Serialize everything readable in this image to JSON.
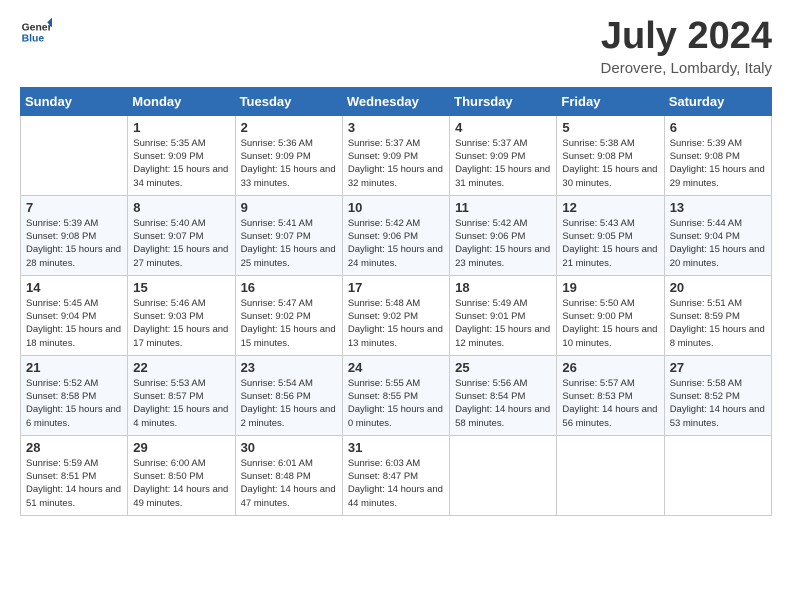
{
  "header": {
    "logo_line1": "General",
    "logo_line2": "Blue",
    "title": "July 2024",
    "subtitle": "Derovere, Lombardy, Italy"
  },
  "weekdays": [
    "Sunday",
    "Monday",
    "Tuesday",
    "Wednesday",
    "Thursday",
    "Friday",
    "Saturday"
  ],
  "weeks": [
    [
      {
        "day": "",
        "empty": true
      },
      {
        "day": "1",
        "sunrise": "Sunrise: 5:35 AM",
        "sunset": "Sunset: 9:09 PM",
        "daylight": "Daylight: 15 hours and 34 minutes."
      },
      {
        "day": "2",
        "sunrise": "Sunrise: 5:36 AM",
        "sunset": "Sunset: 9:09 PM",
        "daylight": "Daylight: 15 hours and 33 minutes."
      },
      {
        "day": "3",
        "sunrise": "Sunrise: 5:37 AM",
        "sunset": "Sunset: 9:09 PM",
        "daylight": "Daylight: 15 hours and 32 minutes."
      },
      {
        "day": "4",
        "sunrise": "Sunrise: 5:37 AM",
        "sunset": "Sunset: 9:09 PM",
        "daylight": "Daylight: 15 hours and 31 minutes."
      },
      {
        "day": "5",
        "sunrise": "Sunrise: 5:38 AM",
        "sunset": "Sunset: 9:08 PM",
        "daylight": "Daylight: 15 hours and 30 minutes."
      },
      {
        "day": "6",
        "sunrise": "Sunrise: 5:39 AM",
        "sunset": "Sunset: 9:08 PM",
        "daylight": "Daylight: 15 hours and 29 minutes."
      }
    ],
    [
      {
        "day": "7",
        "sunrise": "Sunrise: 5:39 AM",
        "sunset": "Sunset: 9:08 PM",
        "daylight": "Daylight: 15 hours and 28 minutes."
      },
      {
        "day": "8",
        "sunrise": "Sunrise: 5:40 AM",
        "sunset": "Sunset: 9:07 PM",
        "daylight": "Daylight: 15 hours and 27 minutes."
      },
      {
        "day": "9",
        "sunrise": "Sunrise: 5:41 AM",
        "sunset": "Sunset: 9:07 PM",
        "daylight": "Daylight: 15 hours and 25 minutes."
      },
      {
        "day": "10",
        "sunrise": "Sunrise: 5:42 AM",
        "sunset": "Sunset: 9:06 PM",
        "daylight": "Daylight: 15 hours and 24 minutes."
      },
      {
        "day": "11",
        "sunrise": "Sunrise: 5:42 AM",
        "sunset": "Sunset: 9:06 PM",
        "daylight": "Daylight: 15 hours and 23 minutes."
      },
      {
        "day": "12",
        "sunrise": "Sunrise: 5:43 AM",
        "sunset": "Sunset: 9:05 PM",
        "daylight": "Daylight: 15 hours and 21 minutes."
      },
      {
        "day": "13",
        "sunrise": "Sunrise: 5:44 AM",
        "sunset": "Sunset: 9:04 PM",
        "daylight": "Daylight: 15 hours and 20 minutes."
      }
    ],
    [
      {
        "day": "14",
        "sunrise": "Sunrise: 5:45 AM",
        "sunset": "Sunset: 9:04 PM",
        "daylight": "Daylight: 15 hours and 18 minutes."
      },
      {
        "day": "15",
        "sunrise": "Sunrise: 5:46 AM",
        "sunset": "Sunset: 9:03 PM",
        "daylight": "Daylight: 15 hours and 17 minutes."
      },
      {
        "day": "16",
        "sunrise": "Sunrise: 5:47 AM",
        "sunset": "Sunset: 9:02 PM",
        "daylight": "Daylight: 15 hours and 15 minutes."
      },
      {
        "day": "17",
        "sunrise": "Sunrise: 5:48 AM",
        "sunset": "Sunset: 9:02 PM",
        "daylight": "Daylight: 15 hours and 13 minutes."
      },
      {
        "day": "18",
        "sunrise": "Sunrise: 5:49 AM",
        "sunset": "Sunset: 9:01 PM",
        "daylight": "Daylight: 15 hours and 12 minutes."
      },
      {
        "day": "19",
        "sunrise": "Sunrise: 5:50 AM",
        "sunset": "Sunset: 9:00 PM",
        "daylight": "Daylight: 15 hours and 10 minutes."
      },
      {
        "day": "20",
        "sunrise": "Sunrise: 5:51 AM",
        "sunset": "Sunset: 8:59 PM",
        "daylight": "Daylight: 15 hours and 8 minutes."
      }
    ],
    [
      {
        "day": "21",
        "sunrise": "Sunrise: 5:52 AM",
        "sunset": "Sunset: 8:58 PM",
        "daylight": "Daylight: 15 hours and 6 minutes."
      },
      {
        "day": "22",
        "sunrise": "Sunrise: 5:53 AM",
        "sunset": "Sunset: 8:57 PM",
        "daylight": "Daylight: 15 hours and 4 minutes."
      },
      {
        "day": "23",
        "sunrise": "Sunrise: 5:54 AM",
        "sunset": "Sunset: 8:56 PM",
        "daylight": "Daylight: 15 hours and 2 minutes."
      },
      {
        "day": "24",
        "sunrise": "Sunrise: 5:55 AM",
        "sunset": "Sunset: 8:55 PM",
        "daylight": "Daylight: 15 hours and 0 minutes."
      },
      {
        "day": "25",
        "sunrise": "Sunrise: 5:56 AM",
        "sunset": "Sunset: 8:54 PM",
        "daylight": "Daylight: 14 hours and 58 minutes."
      },
      {
        "day": "26",
        "sunrise": "Sunrise: 5:57 AM",
        "sunset": "Sunset: 8:53 PM",
        "daylight": "Daylight: 14 hours and 56 minutes."
      },
      {
        "day": "27",
        "sunrise": "Sunrise: 5:58 AM",
        "sunset": "Sunset: 8:52 PM",
        "daylight": "Daylight: 14 hours and 53 minutes."
      }
    ],
    [
      {
        "day": "28",
        "sunrise": "Sunrise: 5:59 AM",
        "sunset": "Sunset: 8:51 PM",
        "daylight": "Daylight: 14 hours and 51 minutes."
      },
      {
        "day": "29",
        "sunrise": "Sunrise: 6:00 AM",
        "sunset": "Sunset: 8:50 PM",
        "daylight": "Daylight: 14 hours and 49 minutes."
      },
      {
        "day": "30",
        "sunrise": "Sunrise: 6:01 AM",
        "sunset": "Sunset: 8:48 PM",
        "daylight": "Daylight: 14 hours and 47 minutes."
      },
      {
        "day": "31",
        "sunrise": "Sunrise: 6:03 AM",
        "sunset": "Sunset: 8:47 PM",
        "daylight": "Daylight: 14 hours and 44 minutes."
      },
      {
        "day": "",
        "empty": true
      },
      {
        "day": "",
        "empty": true
      },
      {
        "day": "",
        "empty": true
      }
    ]
  ]
}
